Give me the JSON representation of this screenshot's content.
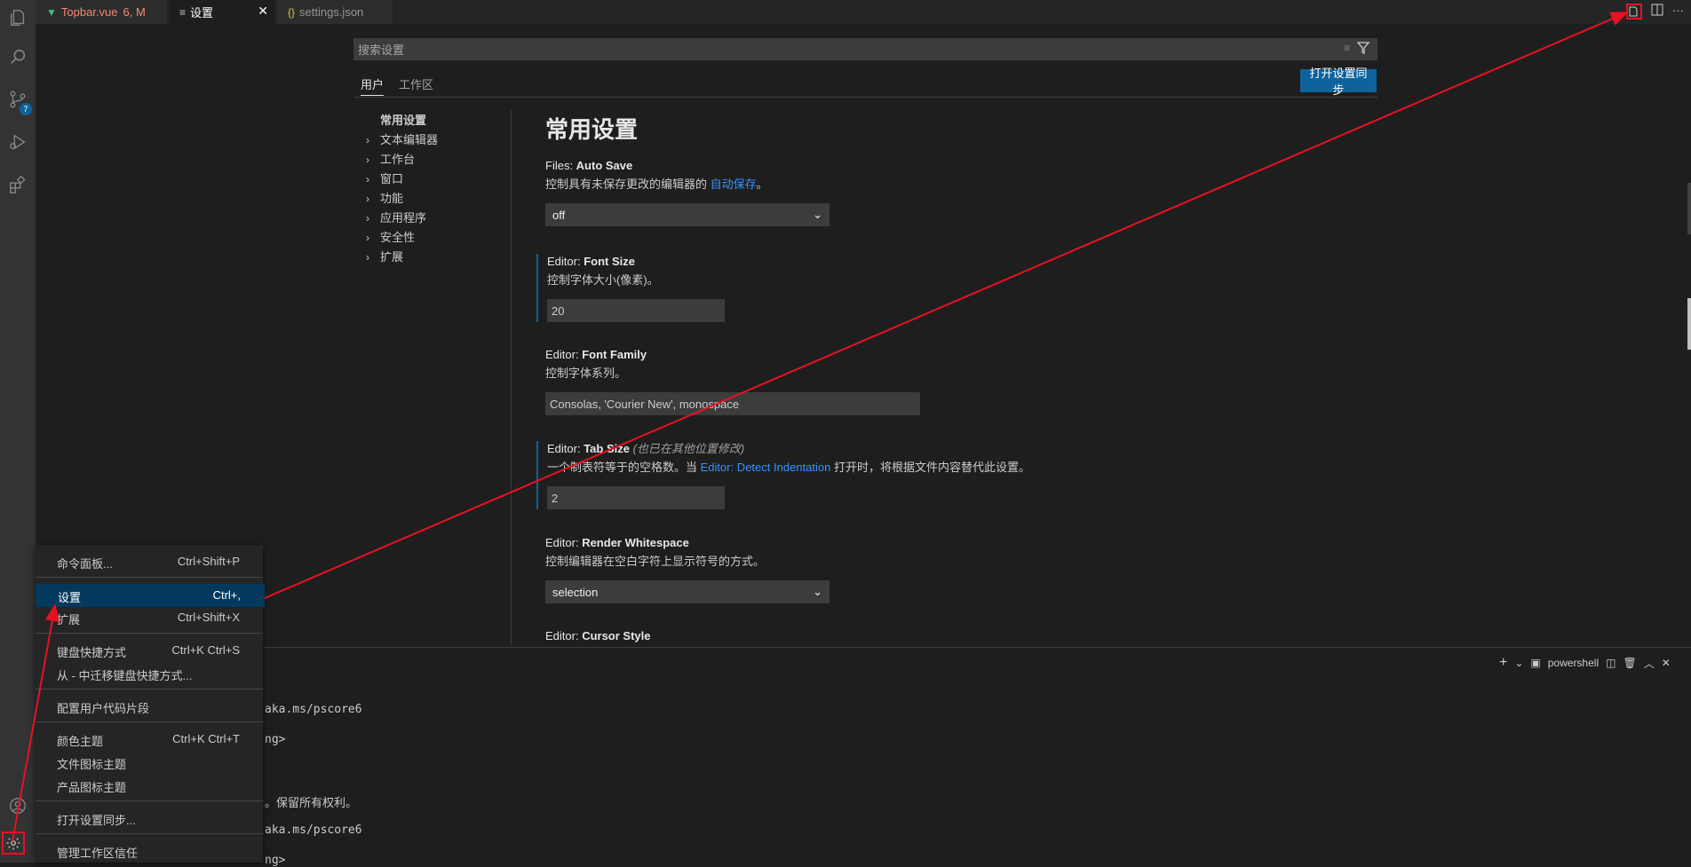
{
  "tabs": [
    {
      "label": "Topbar.vue",
      "status": "6, M",
      "icon": "vue-icon"
    },
    {
      "label": "设置",
      "icon": "settings-file-icon"
    },
    {
      "label": "settings.json",
      "icon": "json-braces-icon"
    }
  ],
  "activity_bar": {
    "scm_badge": "7"
  },
  "search": {
    "placeholder": "搜索设置"
  },
  "scopes": {
    "user": "用户",
    "workspace": "工作区"
  },
  "sync_button": "打开设置同步",
  "toc": {
    "items": [
      "常用设置",
      "文本编辑器",
      "工作台",
      "窗口",
      "功能",
      "应用程序",
      "安全性",
      "扩展"
    ]
  },
  "section_title": "常用设置",
  "settings": [
    {
      "category": "Files: ",
      "name": "Auto Save",
      "desc_prefix": "控制具有未保存更改的编辑器的 ",
      "desc_link": "自动保存",
      "desc_suffix": "。",
      "value": "off"
    },
    {
      "category": "Editor: ",
      "name": "Font Size",
      "desc": "控制字体大小(像素)。",
      "value": "20"
    },
    {
      "category": "Editor: ",
      "name": "Font Family",
      "desc": "控制字体系列。",
      "value": "Consolas, 'Courier New', monospace"
    },
    {
      "category": "Editor: ",
      "name": "Tab Size",
      "note": "(也已在其他位置修改)",
      "desc_prefix": "一个制表符等于的空格数。当 ",
      "desc_link": "Editor: Detect Indentation",
      "desc_suffix": " 打开时，将根据文件内容替代此设置。",
      "value": "2"
    },
    {
      "category": "Editor: ",
      "name": "Render Whitespace",
      "desc": "控制编辑器在空白字符上显示符号的方式。",
      "value": "selection"
    },
    {
      "category": "Editor: ",
      "name": "Cursor Style"
    }
  ],
  "panel": {
    "shell": "powershell"
  },
  "terminal_lines": [
    "aka.ms/pscore6",
    "ng>",
    "。保留所有权利。",
    "aka.ms/pscore6",
    "ng>"
  ],
  "menu": [
    {
      "label": "命令面板...",
      "key": "Ctrl+Shift+P"
    },
    {
      "label": "设置",
      "key": "Ctrl+,"
    },
    {
      "label": "扩展",
      "key": "Ctrl+Shift+X"
    },
    {
      "label": "键盘快捷方式",
      "key": "Ctrl+K Ctrl+S"
    },
    {
      "label": "从 - 中迁移键盘快捷方式...",
      "key": ""
    },
    {
      "label": "配置用户代码片段",
      "key": ""
    },
    {
      "label": "颜色主题",
      "key": "Ctrl+K Ctrl+T"
    },
    {
      "label": "文件图标主题",
      "key": ""
    },
    {
      "label": "产品图标主题",
      "key": ""
    },
    {
      "label": "打开设置同步...",
      "key": ""
    },
    {
      "label": "管理工作区信任",
      "key": ""
    }
  ],
  "colors": {
    "accent": "#0e639c",
    "annotation_arrow": "#e81123",
    "modified_tab": "#f48771"
  }
}
